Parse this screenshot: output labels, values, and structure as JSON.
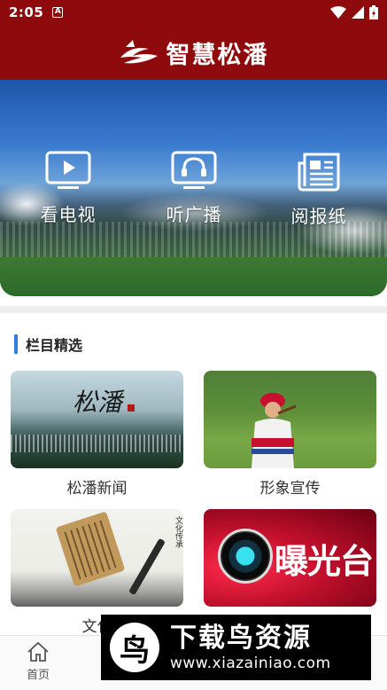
{
  "status_bar": {
    "time": "2:05",
    "notification_icon": "a-icon"
  },
  "header": {
    "title": "智慧松潘",
    "logo_icon": "songpan-logo-icon",
    "background_color": "#8f0a0c"
  },
  "hero": {
    "items": [
      {
        "label": "看电视",
        "icon": "tv-icon"
      },
      {
        "label": "听广播",
        "icon": "headphones-icon"
      },
      {
        "label": "阅报纸",
        "icon": "newspaper-icon"
      }
    ]
  },
  "section": {
    "title": "栏目精选",
    "accent_color": "#2f7de1",
    "cards": [
      {
        "caption": "松潘新闻",
        "thumb_text": "松潘"
      },
      {
        "caption": "形象宣传"
      },
      {
        "caption": "文化",
        "thumb_text": "文化传承"
      },
      {
        "caption": "",
        "thumb_text": "曝光台"
      }
    ]
  },
  "bottom_nav": {
    "tabs": [
      {
        "label": "首页",
        "icon": "home-icon"
      }
    ]
  },
  "watermark": {
    "logo_glyph": "鸟",
    "title": "下载鸟资源",
    "url": "www.xiazainiao.com"
  }
}
